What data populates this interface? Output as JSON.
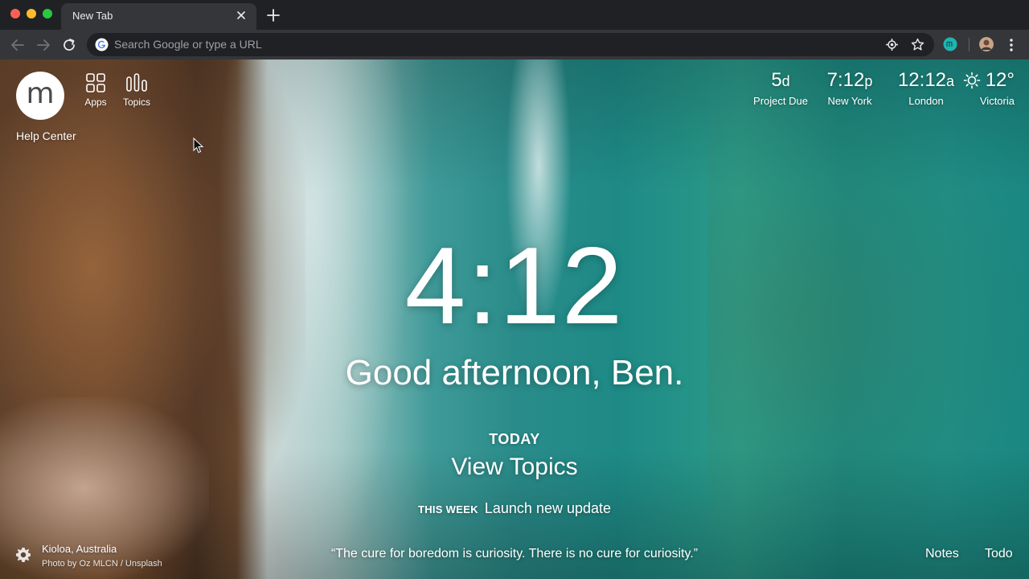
{
  "browser": {
    "tab_title": "New Tab",
    "omnibox_placeholder": "Search Google or type a URL"
  },
  "launcher": {
    "help_center": "Help Center",
    "apps_label": "Apps",
    "topics_label": "Topics",
    "logo_letter": "m"
  },
  "clocks": [
    {
      "value": "5",
      "suffix": "d",
      "label": "Project Due"
    },
    {
      "value": "7:12",
      "suffix": "p",
      "label": "New York"
    },
    {
      "value": "12:12",
      "suffix": "a",
      "label": "London"
    }
  ],
  "weather": {
    "temp": "12°",
    "location": "Victoria"
  },
  "main": {
    "time": "4:12",
    "greeting": "Good afternoon, Ben.",
    "today_label": "TODAY",
    "focus": "View Topics",
    "week_label": "THIS WEEK",
    "week_text": "Launch new update"
  },
  "footer": {
    "photo_location": "Kioloa, Australia",
    "photo_credit": "Photo by Oz MLCN / Unsplash",
    "quote": "“The cure for boredom is curiosity. There is no cure for curiosity.”",
    "notes": "Notes",
    "todo": "Todo"
  }
}
